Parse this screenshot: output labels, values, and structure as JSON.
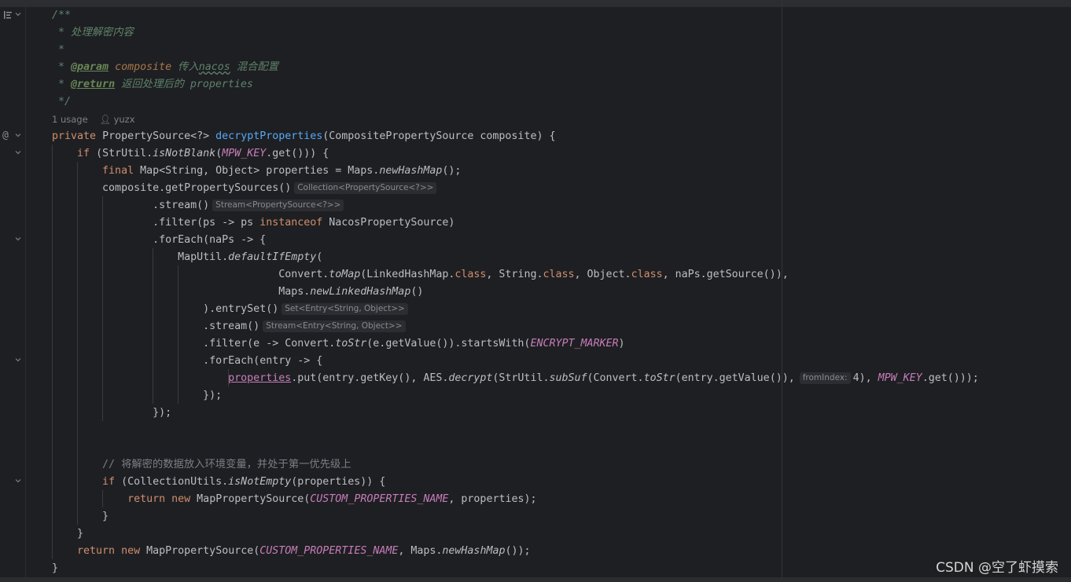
{
  "editor": {
    "usage_info": {
      "usages": "1 usage",
      "author": "yuzx"
    },
    "javadoc": {
      "open": "/**",
      "description": "* 处理解密内容",
      "empty": "*",
      "param_tag": "@param",
      "param_name": "composite",
      "param_desc_a": "传入",
      "param_desc_nacos": "nacos",
      "param_desc_b": "混合配置",
      "return_tag": "@return",
      "return_desc": "返回处理后的 properties",
      "close": "*/"
    },
    "code": {
      "sig_private": "private",
      "sig_type": "PropertySource<?>",
      "sig_method": "decryptProperties",
      "sig_params": "(CompositePropertySource composite) {",
      "if1_kw": "if",
      "if1_a": "(StrUtil.",
      "if1_method": "isNotBlank",
      "if1_b": "(",
      "if1_const": "MPW_KEY",
      "if1_c": ".get())) {",
      "final_kw": "final",
      "final_a": "Map<String, Object> properties = Maps.",
      "final_method": "newHashMap",
      "final_b": "();",
      "getps": "composite.getPropertySources()",
      "hint_getps": "Collection<PropertySource<?>>",
      "stream1": ".stream()",
      "hint_stream1": "Stream<PropertySource<?>>",
      "filter1_a": ".filter(ps -> ps ",
      "filter1_kw": "instanceof",
      "filter1_b": " NacosPropertySource)",
      "foreach1": ".forEach(naPs -> {",
      "maputil_a": "MapUtil.",
      "maputil_method": "defaultIfEmpty",
      "maputil_b": "(",
      "convert_a": "Convert.",
      "convert_method": "toMap",
      "convert_b": "(LinkedHashMap.",
      "convert_class1": "class",
      "convert_c": ", String.",
      "convert_class2": "class",
      "convert_d": ", Object.",
      "convert_class3": "class",
      "convert_e": ", naPs.getSource()),",
      "maps_a": "Maps.",
      "maps_method": "newLinkedHashMap",
      "maps_b": "()",
      "entryset": ").entrySet()",
      "hint_entryset": "Set<Entry<String, Object>>",
      "stream2": ".stream()",
      "hint_stream2": "Stream<Entry<String, Object>>",
      "filter2_a": ".filter(e -> Convert.",
      "filter2_method": "toStr",
      "filter2_b": "(e.getValue()).startsWith(",
      "filter2_const": "ENCRYPT_MARKER",
      "filter2_c": ")",
      "foreach2": ".forEach(entry -> {",
      "put_field": "properties",
      "put_a": ".put(entry.getKey(), AES.",
      "put_method": "decrypt",
      "put_b": "(StrUtil.",
      "put_method2": "subSuf",
      "put_c": "(Convert.",
      "put_method3": "toStr",
      "put_d": "(entry.getValue()),",
      "put_hint": "fromIndex:",
      "put_e": "4), ",
      "put_const": "MPW_KEY",
      "put_f": ".get()));",
      "close_foreach2": "});",
      "close_foreach1": "});",
      "comment": "// 将解密的数据放入环境变量，并处于第一优先级上",
      "if2_kw": "if",
      "if2_a": "(CollectionUtils.",
      "if2_method": "isNotEmpty",
      "if2_b": "(properties)) {",
      "ret1_kw": "return",
      "ret1_new": "new",
      "ret1_a": " MapPropertySource(",
      "ret1_const": "CUSTOM_PROPERTIES_NAME",
      "ret1_b": ", properties);",
      "brace_if2": "}",
      "brace_if1": "}",
      "ret2_kw": "return",
      "ret2_new": "new",
      "ret2_a": " MapPropertySource(",
      "ret2_const": "CUSTOM_PROPERTIES_NAME",
      "ret2_b": ", Maps.",
      "ret2_method": "newHashMap",
      "ret2_c": "());",
      "brace_method": "}"
    }
  },
  "watermark": "CSDN @空了虾摸索"
}
